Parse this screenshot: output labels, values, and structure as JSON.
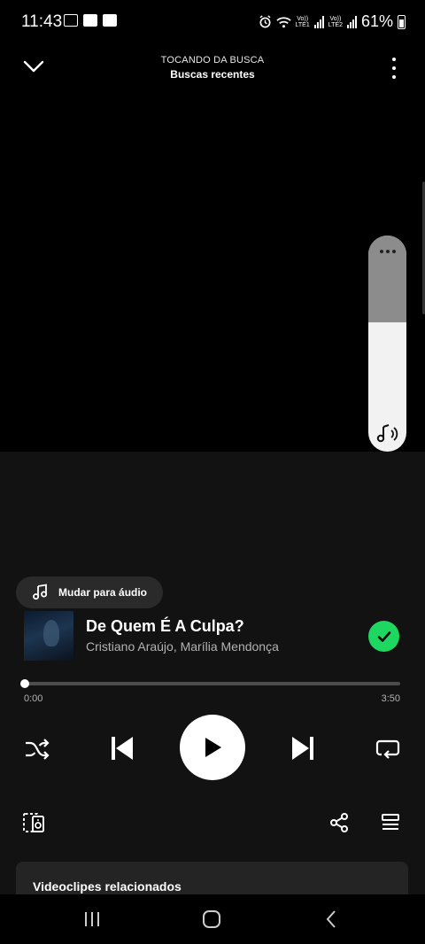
{
  "status_bar": {
    "time": "11:43",
    "battery": "61%",
    "sim1": "LTE1",
    "sim2": "LTE2",
    "volte": "Vo))"
  },
  "header": {
    "context_label": "TOCANDO DA BUSCA",
    "context_title": "Buscas recentes"
  },
  "volume": {
    "level": 0.6
  },
  "switch_chip": {
    "label": "Mudar para áudio"
  },
  "track": {
    "title": "De Quem É A Culpa?",
    "artists": "Cristiano Araújo, Marília Mendonça",
    "liked": true
  },
  "playback": {
    "current_time": "0:00",
    "total_time": "3:50",
    "progress": 0.0
  },
  "related": {
    "title": "Videoclipes relacionados"
  },
  "colors": {
    "accent": "#1ed760",
    "background": "#000000",
    "panel": "#121212"
  }
}
